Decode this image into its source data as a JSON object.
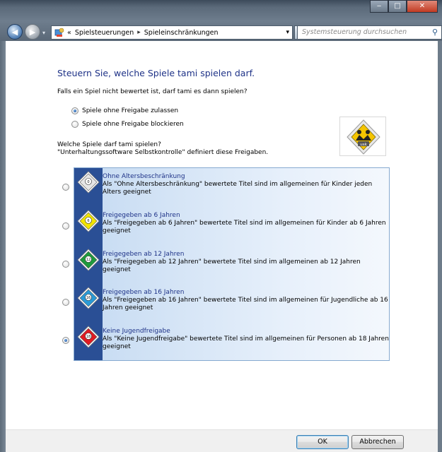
{
  "window": {
    "controls": {
      "minimize": "‒",
      "maximize": "□",
      "close": "✕"
    }
  },
  "nav": {
    "back_icon": "back-arrow-icon",
    "forward_icon": "forward-arrow-icon",
    "breadcrumb_prefix": "«",
    "breadcrumbs": [
      "Spielsteuerungen",
      "Spieleinschränkungen"
    ],
    "breadcrumb_separator": "▸",
    "search_placeholder": "Systemsteuerung durchsuchen"
  },
  "main": {
    "heading": "Steuern Sie, welche Spiele tami spielen darf.",
    "unrated_question": "Falls ein Spiel nicht bewertet ist, darf tami es dann spielen?",
    "unrated_options": [
      {
        "label": "Spiele ohne Freigabe zulassen",
        "selected": true
      },
      {
        "label": "Spiele ohne Freigabe blockieren",
        "selected": false
      }
    ],
    "rating_question_line1": "Welche Spiele darf tami spielen?",
    "rating_question_line2": "\"Unterhaltungssoftware Selbstkontrolle\" definiert diese Freigaben.",
    "usk_logo_text": "usk",
    "ratings": [
      {
        "title": "Ohne Altersbeschränkung",
        "description": "Als \"Ohne Altersbeschränkung\" bewertete Titel sind im allgemeinen für Kinder jeden Alters geeignet",
        "color": "#e6e6e6",
        "badge_text": "0",
        "selected": false
      },
      {
        "title": "Freigegeben ab 6 Jahren",
        "description": "Als \"Freigegeben ab 6 Jahren\" bewertete Titel sind im allgemeinen für Kinder ab 6 Jahren geeignet",
        "color": "#f2e500",
        "badge_text": "6",
        "selected": false
      },
      {
        "title": "Freigegeben ab 12 Jahren",
        "description": "Als \"Freigegeben ab 12 Jahren\" bewertete Titel sind im allgemeinen ab 12 Jahren geeignet",
        "color": "#1e9a3c",
        "badge_text": "12",
        "selected": false
      },
      {
        "title": "Freigegeben ab 16 Jahren",
        "description": "Als \"Freigegeben ab 16 Jahren\" bewertete Titel sind im allgemeinen für Jugendliche ab 16 Jahren geeignet",
        "color": "#2a9ad6",
        "badge_text": "16",
        "selected": false
      },
      {
        "title": "Keine Jugendfreigabe",
        "description": "Als \"Keine Jugendfreigabe\" bewertete Titel sind im allgemeinen für Personen ab 18 Jahren geeignet",
        "color": "#e11b22",
        "badge_text": "18",
        "selected": true
      }
    ]
  },
  "footer": {
    "ok_label": "OK",
    "cancel_label": "Abbrechen"
  }
}
